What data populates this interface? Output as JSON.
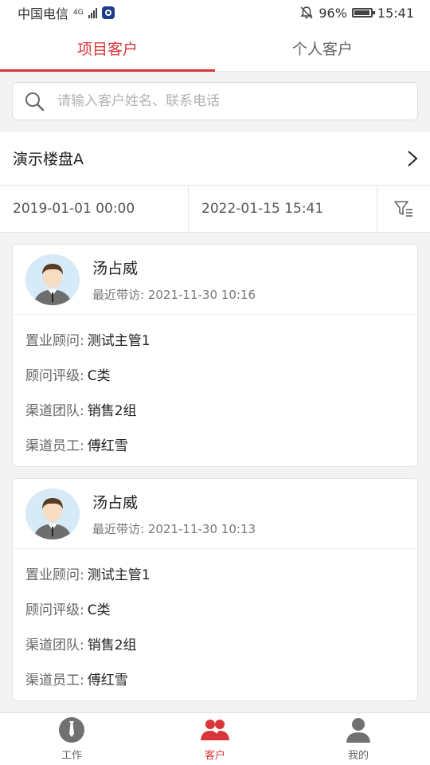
{
  "status_bar": {
    "carrier": "中国电信",
    "network": "4G",
    "battery": "96%",
    "battery_level": 0.96,
    "time": "15:41"
  },
  "tabs": [
    {
      "label": "项目客户",
      "active": true
    },
    {
      "label": "个人客户",
      "active": false
    }
  ],
  "search": {
    "placeholder": "请输入客户姓名、联系电话",
    "value": ""
  },
  "project": {
    "name": "演示楼盘A"
  },
  "date_range": {
    "start": "2019-01-01 00:00",
    "end": "2022-01-15 15:41"
  },
  "customers": [
    {
      "name": "汤占威",
      "visit_label": "最近带访:",
      "visit_time": "2021-11-30 10:16",
      "fields": [
        {
          "label": "置业顾问:",
          "value": "测试主管1"
        },
        {
          "label": "顾问评级:",
          "value": "C类"
        },
        {
          "label": "渠道团队:",
          "value": "销售2组"
        },
        {
          "label": "渠道员工:",
          "value": "傅红雪"
        }
      ]
    },
    {
      "name": "汤占威",
      "visit_label": "最近带访:",
      "visit_time": "2021-11-30 10:13",
      "fields": [
        {
          "label": "置业顾问:",
          "value": "测试主管1"
        },
        {
          "label": "顾问评级:",
          "value": "C类"
        },
        {
          "label": "渠道团队:",
          "value": "销售2组"
        },
        {
          "label": "渠道员工:",
          "value": "傅红雪"
        }
      ]
    }
  ],
  "bottom_nav": [
    {
      "label": "工作",
      "icon": "work-icon",
      "active": false
    },
    {
      "label": "客户",
      "icon": "customers-icon",
      "active": true
    },
    {
      "label": "我的",
      "icon": "profile-icon",
      "active": false
    }
  ],
  "colors": {
    "accent": "#d9363a",
    "background": "#f3f3f3"
  }
}
